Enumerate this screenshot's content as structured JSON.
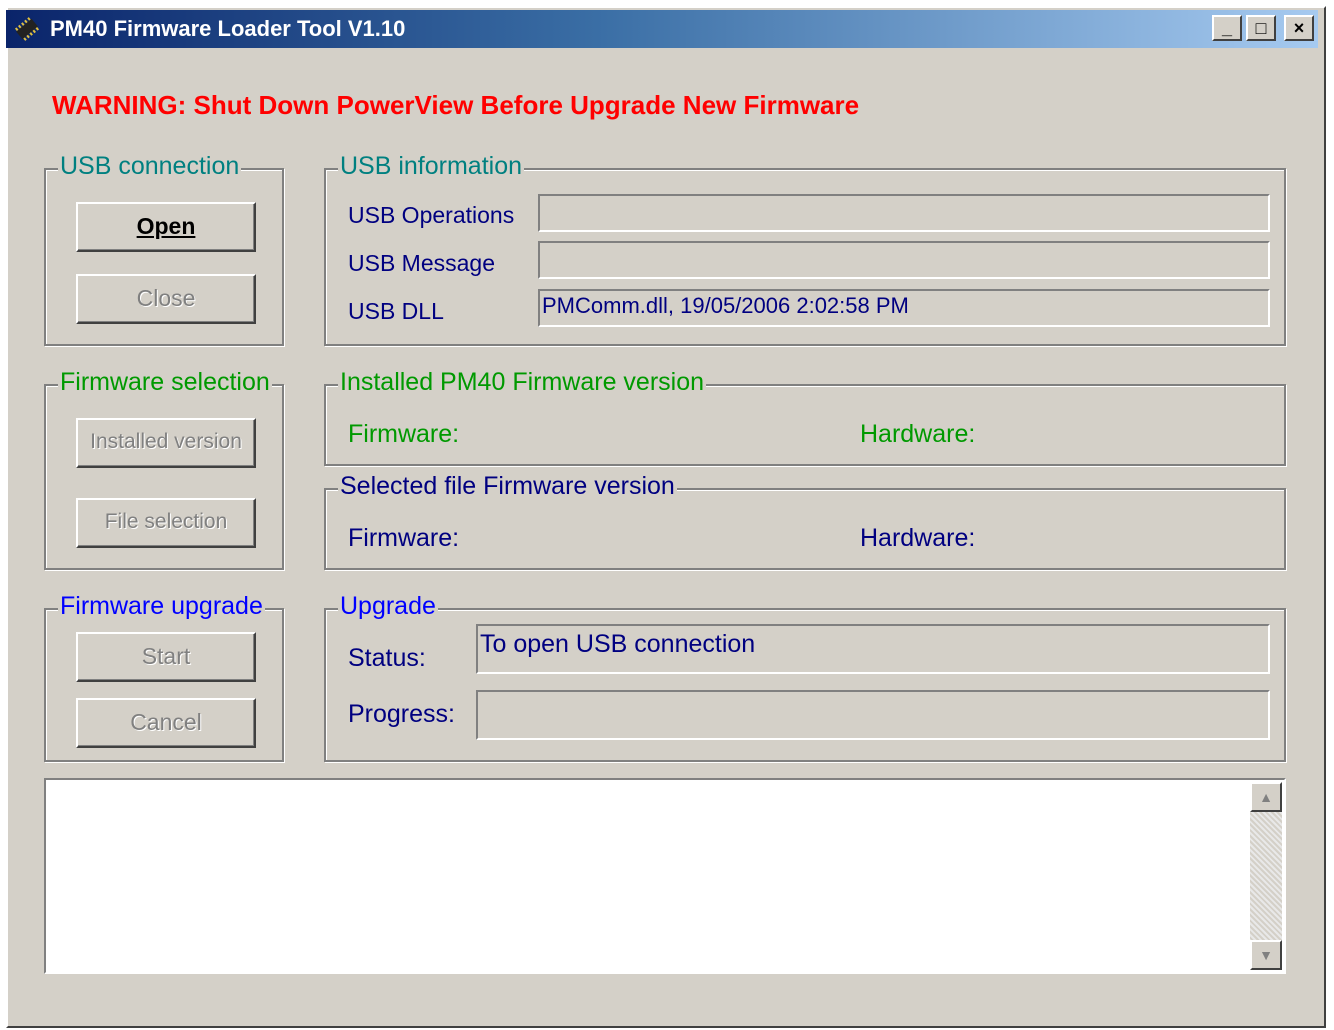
{
  "window": {
    "title": "PM40 Firmware Loader Tool V1.10",
    "controls": {
      "minimize": "_",
      "maximize": "□",
      "close": "×"
    }
  },
  "warning": "WARNING: Shut Down PowerView Before Upgrade New Firmware",
  "usb_connection": {
    "legend": "USB connection",
    "open_button": "Open",
    "close_button": "Close"
  },
  "usb_information": {
    "legend": "USB information",
    "operations_label": "USB Operations",
    "operations_value": "",
    "message_label": "USB Message",
    "message_value": "",
    "dll_label": "USB DLL",
    "dll_value": "PMComm.dll, 19/05/2006 2:02:58 PM"
  },
  "firmware_selection": {
    "legend": "Firmware selection",
    "installed_version_button": "Installed version",
    "file_selection_button": "File selection"
  },
  "installed_version": {
    "legend": "Installed PM40 Firmware version",
    "firmware_label": "Firmware:",
    "hardware_label": "Hardware:"
  },
  "selected_file_version": {
    "legend": "Selected file Firmware version",
    "firmware_label": "Firmware:",
    "hardware_label": "Hardware:"
  },
  "firmware_upgrade": {
    "legend": "Firmware upgrade",
    "start_button": "Start",
    "cancel_button": "Cancel"
  },
  "upgrade": {
    "legend": "Upgrade",
    "status_label": "Status:",
    "status_value": "To open USB connection",
    "progress_label": "Progress:",
    "progress_fraction": 0
  },
  "log": {
    "text": ""
  },
  "icons": [
    "chip-icon",
    "scroll-up-arrow-icon",
    "scroll-down-arrow-icon"
  ],
  "colors": {
    "warning": "#ff0000",
    "usb_legend": "#008080",
    "firmware_legend": "#009900",
    "upgrade_legend": "#0000ff",
    "window_bg": "#d4d0c8"
  }
}
